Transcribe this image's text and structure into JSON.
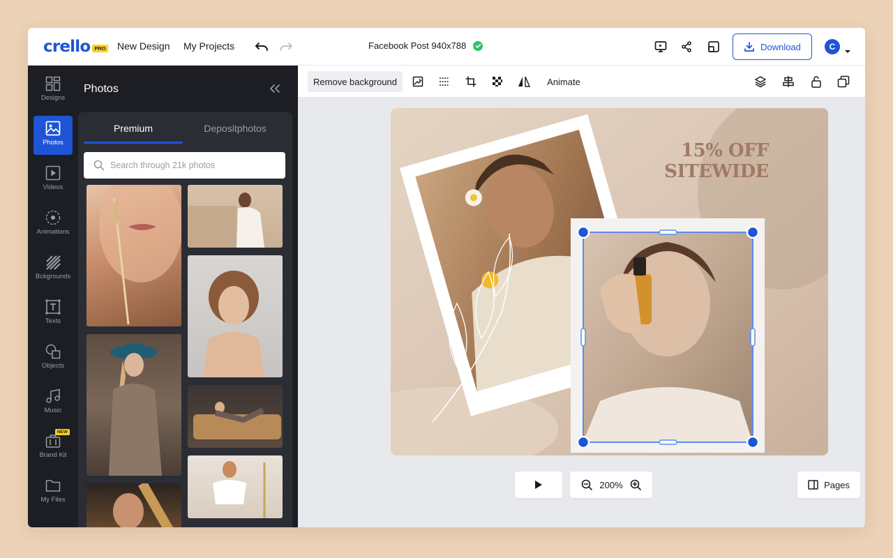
{
  "header": {
    "logo_text": "crello",
    "logo_badge": "PRO",
    "new_design": "New Design",
    "my_projects": "My Projects",
    "doc_title": "Facebook Post 940x788",
    "download": "Download",
    "avatar_letter": "C"
  },
  "rail": {
    "items": [
      {
        "label": "Designs",
        "icon": "grid-icon"
      },
      {
        "label": "Photos",
        "icon": "image-icon",
        "active": true
      },
      {
        "label": "Videos",
        "icon": "video-icon"
      },
      {
        "label": "Animations",
        "icon": "animation-icon"
      },
      {
        "label": "Bckgrounds",
        "icon": "background-icon"
      },
      {
        "label": "Texts",
        "icon": "text-icon"
      },
      {
        "label": "Objects",
        "icon": "shapes-icon"
      },
      {
        "label": "Music",
        "icon": "music-icon"
      },
      {
        "label": "Brand Kit",
        "icon": "briefcase-icon",
        "badge": "NEW"
      },
      {
        "label": "My Files",
        "icon": "folder-icon"
      }
    ]
  },
  "panel": {
    "title": "Photos",
    "tabs": [
      "Premium",
      "Depositphotos"
    ],
    "search_placeholder": "Search through 21k photos"
  },
  "toolbar": {
    "remove_background": "Remove background",
    "animate": "Animate"
  },
  "canvas": {
    "promo_line1": "15% OFF",
    "promo_line2": "SITEWIDE"
  },
  "bottom": {
    "zoom": "200%",
    "pages": "Pages"
  },
  "colors": {
    "brand": "#1e55d6",
    "sidebar": "#1d1e24",
    "panel": "#2b2d35",
    "canvas_bg": "#d9c6b4",
    "promo_text": "#a17a63",
    "page_bg": "#ecd2b6"
  }
}
